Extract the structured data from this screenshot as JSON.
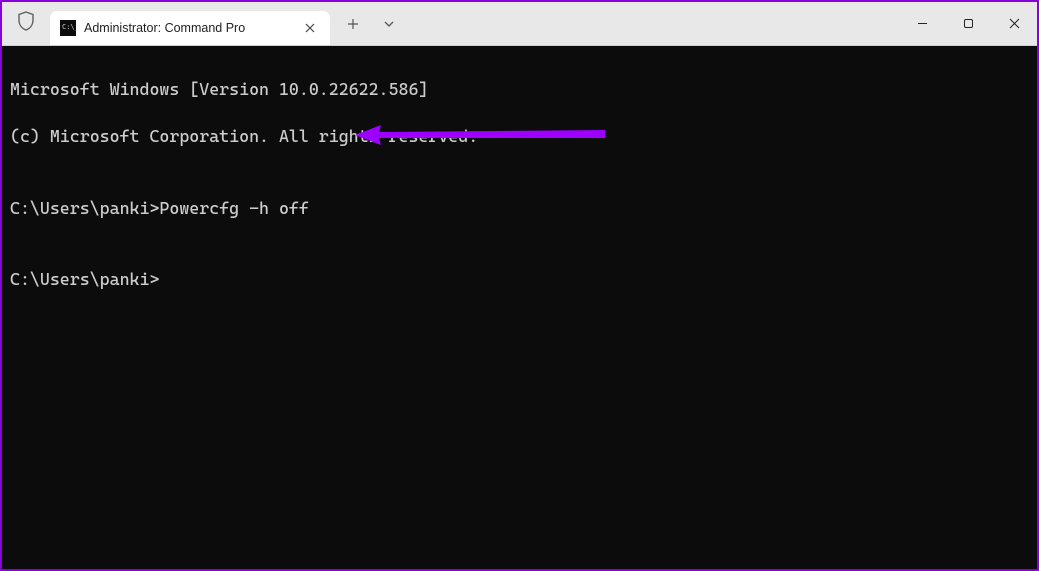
{
  "window": {
    "tab_title": "Administrator: Command Pro"
  },
  "terminal": {
    "line1": "Microsoft Windows [Version 10.0.22622.586]",
    "line2": "(c) Microsoft Corporation. All rights reserved.",
    "blank1": "",
    "prompt1_path": "C:\\Users\\panki>",
    "prompt1_cmd": "Powercfg -h off",
    "blank2": "",
    "prompt2_path": "C:\\Users\\panki>"
  },
  "annotation": {
    "color": "#9d00ff"
  }
}
